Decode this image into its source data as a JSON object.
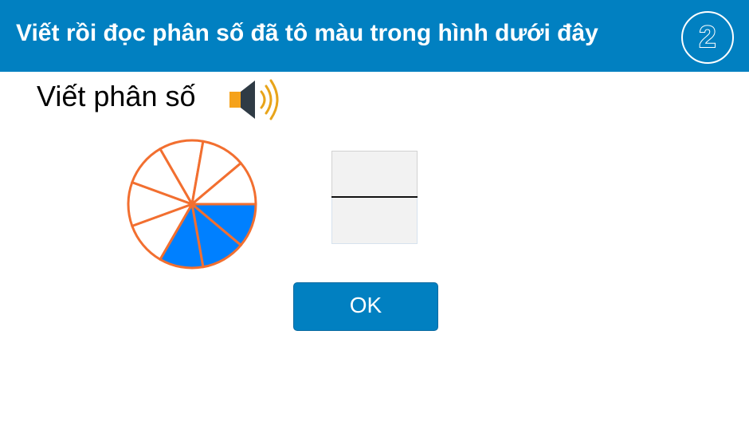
{
  "header": {
    "title": "Viết rồi đọc phân số đã tô màu trong hình dưới đây",
    "step_number": "2"
  },
  "instruction": {
    "text": "Viết phân số",
    "audio_icon": "speaker-icon"
  },
  "pie": {
    "total_parts": 9,
    "shaded_parts": 3,
    "shaded_color": "#0080ff",
    "outline_color": "#f26f30"
  },
  "fraction_input": {
    "numerator": "",
    "denominator": ""
  },
  "ok_button": {
    "label": "OK"
  },
  "colors": {
    "header_bg": "#0180c1",
    "speaker_body": "#f5a21b",
    "speaker_waves": "#e8a41a"
  }
}
